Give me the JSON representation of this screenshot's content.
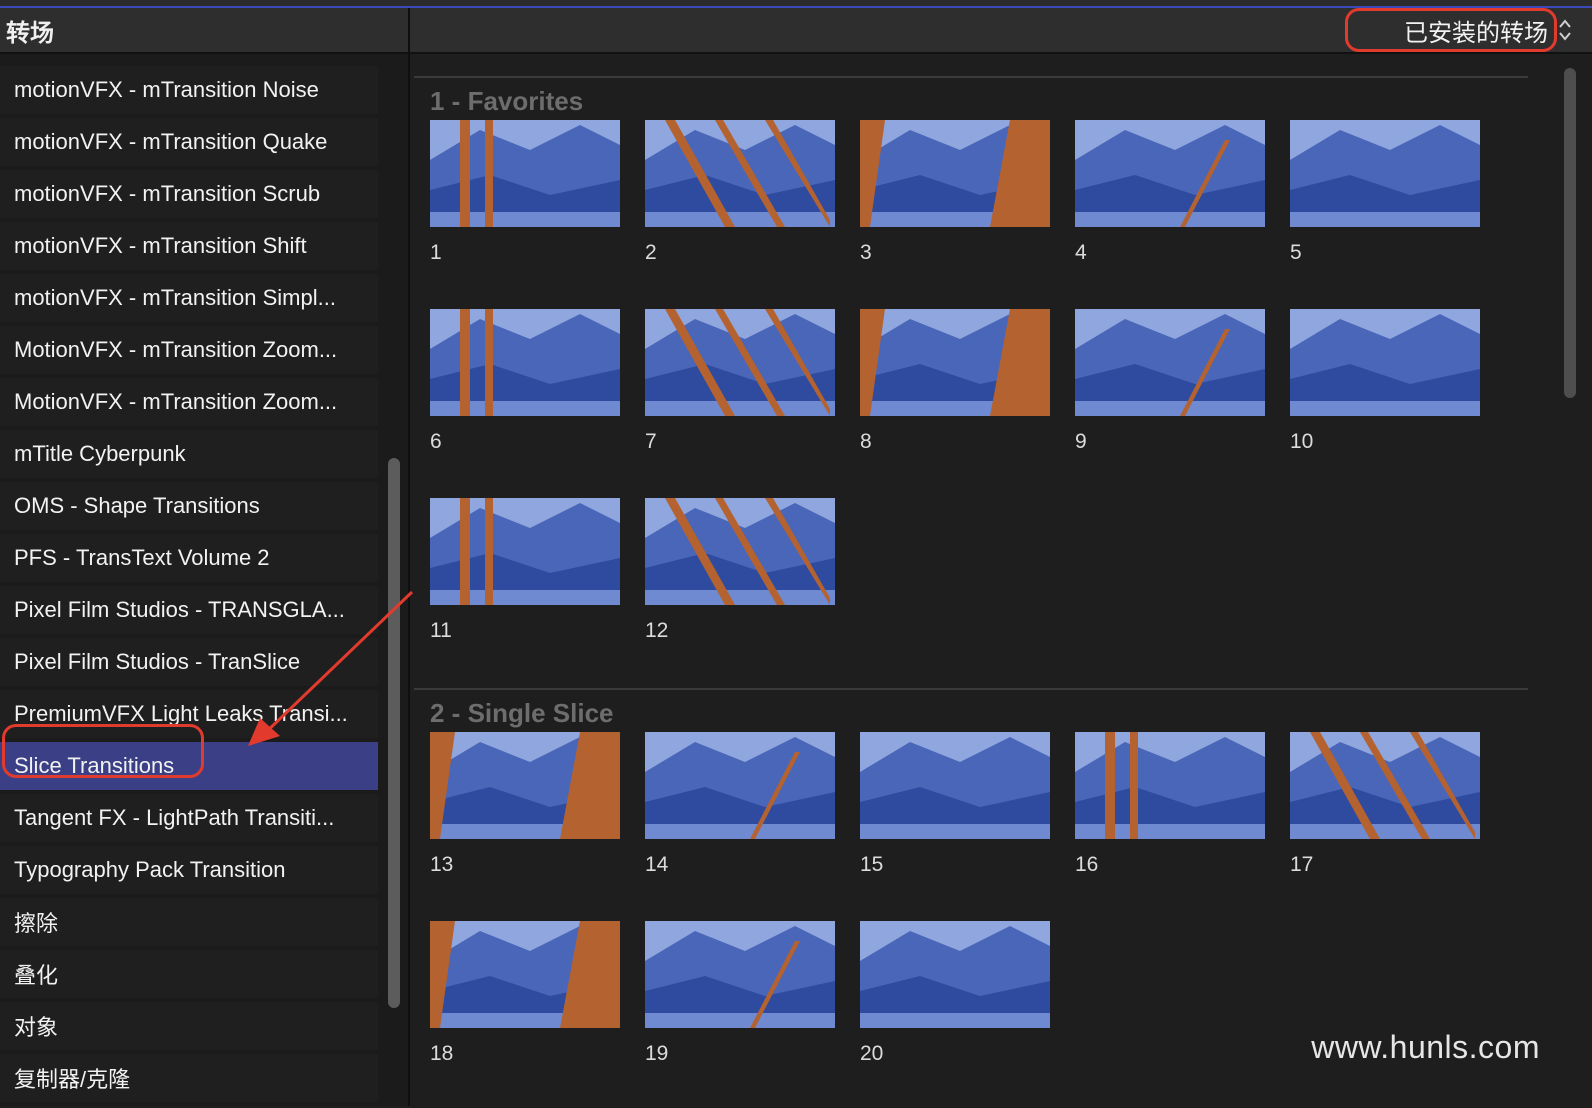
{
  "sidebar": {
    "title": "转场",
    "items": [
      {
        "label": "motionVFX - mTransition Noise",
        "selected": false
      },
      {
        "label": "motionVFX - mTransition Quake",
        "selected": false
      },
      {
        "label": "motionVFX - mTransition Scrub",
        "selected": false
      },
      {
        "label": "motionVFX - mTransition Shift",
        "selected": false
      },
      {
        "label": "motionVFX - mTransition Simpl...",
        "selected": false
      },
      {
        "label": "MotionVFX - mTransition Zoom...",
        "selected": false
      },
      {
        "label": "MotionVFX - mTransition Zoom...",
        "selected": false
      },
      {
        "label": "mTitle Cyberpunk",
        "selected": false
      },
      {
        "label": "OMS - Shape Transitions",
        "selected": false
      },
      {
        "label": "PFS - TransText Volume 2",
        "selected": false
      },
      {
        "label": "Pixel Film Studios - TRANSGLA...",
        "selected": false
      },
      {
        "label": "Pixel Film Studios - TranSlice",
        "selected": false
      },
      {
        "label": "PremiumVFX Light Leaks Transi...",
        "selected": false
      },
      {
        "label": "Slice Transitions",
        "selected": true
      },
      {
        "label": "Tangent FX - LightPath Transiti...",
        "selected": false
      },
      {
        "label": "Typography Pack Transition",
        "selected": false
      },
      {
        "label": "擦除",
        "selected": false
      },
      {
        "label": "叠化",
        "selected": false
      },
      {
        "label": "对象",
        "selected": false
      },
      {
        "label": "复制器/克隆",
        "selected": false
      }
    ]
  },
  "filter": {
    "label": "已安装的转场"
  },
  "sections": [
    {
      "title": "1 - Favorites",
      "items": [
        "1",
        "2",
        "3",
        "4",
        "5",
        "6",
        "7",
        "8",
        "9",
        "10",
        "11",
        "12"
      ]
    },
    {
      "title": "2 - Single Slice",
      "items": [
        "13",
        "14",
        "15",
        "16",
        "17",
        "18",
        "19",
        "20"
      ]
    }
  ],
  "watermark": "www.hunls.com",
  "colors": {
    "selection": "#3b3f86",
    "annotation": "#e23b2e",
    "thumb_blue": "#4a66b8",
    "thumb_orange": "#b4622f"
  },
  "icons": {
    "dropdown": "chevron-up-down-icon",
    "annotation_arrow": "arrow-icon"
  }
}
